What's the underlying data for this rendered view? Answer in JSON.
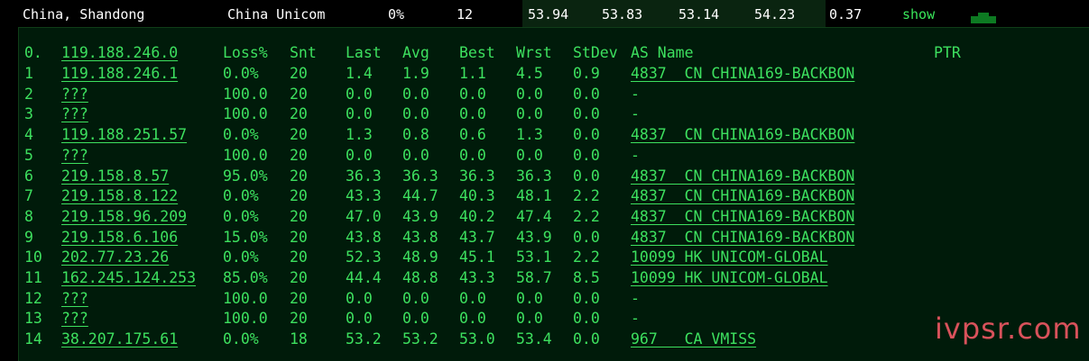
{
  "summary": {
    "location": "China, Shandong",
    "isp": "China Unicom",
    "loss": "0%",
    "sent": "12",
    "last": "53.94",
    "avg": "53.83",
    "best": "53.14",
    "worst": "54.23",
    "stdev": "0.37",
    "show_label": "show"
  },
  "header": {
    "hop": "0.",
    "host": "119.188.246.0",
    "loss": "Loss%",
    "snt": "Snt",
    "last": "Last",
    "avg": "Avg",
    "best": "Best",
    "wrst": "Wrst",
    "stdev": "StDev",
    "as": "AS Name",
    "ptr": "PTR"
  },
  "hops": [
    {
      "hop": "1",
      "host": "119.188.246.1",
      "loss": "0.0%",
      "snt": "20",
      "last": "1.4",
      "avg": "1.9",
      "best": "1.1",
      "wrst": "4.5",
      "stdev": "0.9",
      "as": "4837  CN CHINA169-BACKBON"
    },
    {
      "hop": "2",
      "host": "???",
      "loss": "100.0",
      "snt": "20",
      "last": "0.0",
      "avg": "0.0",
      "best": "0.0",
      "wrst": "0.0",
      "stdev": "0.0",
      "as": "-"
    },
    {
      "hop": "3",
      "host": "???",
      "loss": "100.0",
      "snt": "20",
      "last": "0.0",
      "avg": "0.0",
      "best": "0.0",
      "wrst": "0.0",
      "stdev": "0.0",
      "as": "-"
    },
    {
      "hop": "4",
      "host": "119.188.251.57",
      "loss": "0.0%",
      "snt": "20",
      "last": "1.3",
      "avg": "0.8",
      "best": "0.6",
      "wrst": "1.3",
      "stdev": "0.0",
      "as": "4837  CN CHINA169-BACKBON"
    },
    {
      "hop": "5",
      "host": "???",
      "loss": "100.0",
      "snt": "20",
      "last": "0.0",
      "avg": "0.0",
      "best": "0.0",
      "wrst": "0.0",
      "stdev": "0.0",
      "as": "-"
    },
    {
      "hop": "6",
      "host": "219.158.8.57",
      "loss": "95.0%",
      "snt": "20",
      "last": "36.3",
      "avg": "36.3",
      "best": "36.3",
      "wrst": "36.3",
      "stdev": "0.0",
      "as": "4837  CN CHINA169-BACKBON"
    },
    {
      "hop": "7",
      "host": "219.158.8.122",
      "loss": "0.0%",
      "snt": "20",
      "last": "43.3",
      "avg": "44.7",
      "best": "40.3",
      "wrst": "48.1",
      "stdev": "2.2",
      "as": "4837  CN CHINA169-BACKBON"
    },
    {
      "hop": "8",
      "host": "219.158.96.209",
      "loss": "0.0%",
      "snt": "20",
      "last": "47.0",
      "avg": "43.9",
      "best": "40.2",
      "wrst": "47.4",
      "stdev": "2.2",
      "as": "4837  CN CHINA169-BACKBON"
    },
    {
      "hop": "9",
      "host": "219.158.6.106",
      "loss": "15.0%",
      "snt": "20",
      "last": "43.8",
      "avg": "43.8",
      "best": "43.7",
      "wrst": "43.9",
      "stdev": "0.0",
      "as": "4837  CN CHINA169-BACKBON"
    },
    {
      "hop": "10",
      "host": "202.77.23.26",
      "loss": "0.0%",
      "snt": "20",
      "last": "52.3",
      "avg": "48.9",
      "best": "45.1",
      "wrst": "53.1",
      "stdev": "2.2",
      "as": "10099 HK UNICOM-GLOBAL"
    },
    {
      "hop": "11",
      "host": "162.245.124.253",
      "loss": "85.0%",
      "snt": "20",
      "last": "44.4",
      "avg": "48.8",
      "best": "43.3",
      "wrst": "58.7",
      "stdev": "8.5",
      "as": "10099 HK UNICOM-GLOBAL"
    },
    {
      "hop": "12",
      "host": "???",
      "loss": "100.0",
      "snt": "20",
      "last": "0.0",
      "avg": "0.0",
      "best": "0.0",
      "wrst": "0.0",
      "stdev": "0.0",
      "as": "-"
    },
    {
      "hop": "13",
      "host": "???",
      "loss": "100.0",
      "snt": "20",
      "last": "0.0",
      "avg": "0.0",
      "best": "0.0",
      "wrst": "0.0",
      "stdev": "0.0",
      "as": "-"
    },
    {
      "hop": "14",
      "host": "38.207.175.61",
      "loss": "0.0%",
      "snt": "18",
      "last": "53.2",
      "avg": "53.2",
      "best": "53.0",
      "wrst": "53.4",
      "stdev": "0.0",
      "as": "967   CA VMISS"
    }
  ],
  "watermark": "ivpsr.com",
  "colors": {
    "text_green": "#3de05f",
    "panel_bg": "#001b0a",
    "watermark": "#ff5c6a"
  }
}
